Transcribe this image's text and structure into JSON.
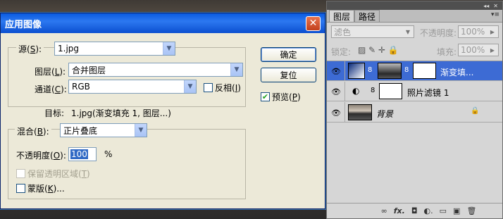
{
  "dialog": {
    "title": "应用图像",
    "close_glyph": "✕",
    "source_label": "源(",
    "source_key": "S",
    "source_close": "):",
    "source_value": "1.jpg",
    "layer_label": "图层(",
    "layer_key": "L",
    "layer_close": "):",
    "layer_value": "合并图层",
    "channel_label": "通道(",
    "channel_key": "C",
    "channel_close": "):",
    "channel_value": "RGB",
    "invert_label": "反相(",
    "invert_key": "I",
    "invert_close": ")",
    "target_label": "目标:",
    "target_value": "1.jpg(渐变填充 1, 图层...)",
    "blend_label": "混合(",
    "blend_key": "B",
    "blend_close": "):",
    "blend_value": "正片叠底",
    "opacity_label": "不透明度(",
    "opacity_key": "O",
    "opacity_close": "):",
    "opacity_value": "100",
    "opacity_unit": "%",
    "preserve_label": "保留透明区域(",
    "preserve_key": "T",
    "preserve_close": ")",
    "mask_label": "蒙版(",
    "mask_key": "K",
    "mask_close": ")...",
    "ok_label": "确定",
    "reset_label": "复位",
    "preview_label": "预览(",
    "preview_key": "P",
    "preview_close": ")",
    "preview_checked": true,
    "check_glyph": "✔",
    "arrow_glyph": "▼"
  },
  "panel": {
    "tabs": [
      "图层",
      "路径"
    ],
    "menu_glyph": "▾≡",
    "collapse_glyph": "◂◂",
    "close_glyph": "✕",
    "blend_mode": "滤色",
    "opacity_label": "不透明度:",
    "opacity_value": "100%",
    "lock_label": "锁定:",
    "fill_label": "填充:",
    "fill_value": "100%",
    "layers": [
      {
        "name": "渐变填...",
        "selected": true
      },
      {
        "name": "照片滤镜 1",
        "selected": false
      },
      {
        "name": "背景",
        "selected": false
      }
    ],
    "eye_glyph": "👁",
    "link_glyph": "8",
    "lock_glyph": "🔒",
    "footer_icons": [
      "∞",
      "fx.",
      "◘",
      "◐.",
      "▭",
      "▣",
      "🗑"
    ]
  },
  "colors": {
    "title_blue": "#0a5be0",
    "dialog_bg": "#ece9d8",
    "panel_bg": "#d6d6d6",
    "selected_layer": "#3d6bd4"
  }
}
